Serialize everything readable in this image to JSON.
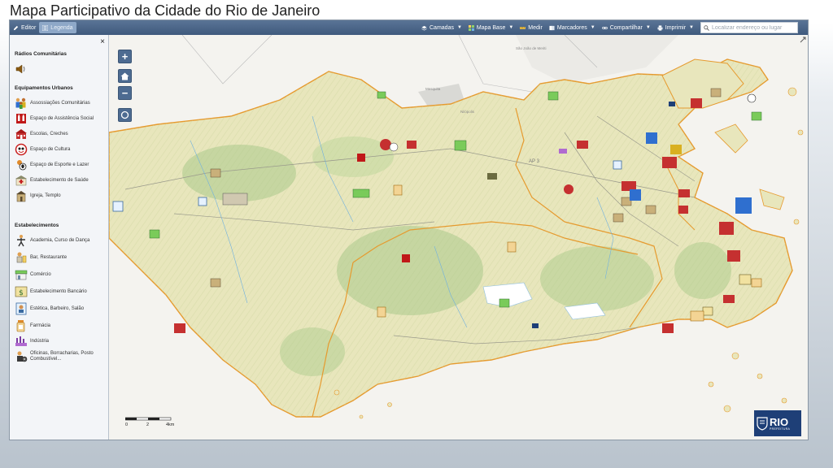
{
  "page": {
    "title": "Mapa Participativo da Cidade do Rio de Janeiro"
  },
  "toolbar": {
    "editor": "Editor",
    "legenda": "Legenda",
    "camadas": "Camadas",
    "mapa_base": "Mapa Base",
    "medir": "Medir",
    "marcadores": "Marcadores",
    "compartilhar": "Compartilhar",
    "imprimir": "Imprimir",
    "search_placeholder": "Localizar endereço ou lugar"
  },
  "legend": {
    "close": "×",
    "sections": [
      {
        "title": "Rádios Comunitárias",
        "items": [
          {
            "label": "",
            "icon": "radio-speaker-icon"
          }
        ]
      },
      {
        "title": "Equipamentos Urbanos",
        "items": [
          {
            "label": "Assossiações Comunitárias",
            "icon": "community-association-icon"
          },
          {
            "label": "Espaço de Assistência Social",
            "icon": "social-assistance-icon"
          },
          {
            "label": "Escolas, Creches",
            "icon": "school-icon"
          },
          {
            "label": "Espaço de Cultura",
            "icon": "culture-icon"
          },
          {
            "label": "Espaço de Esporte e Lazer",
            "icon": "sports-icon"
          },
          {
            "label": "Estabelecimento de Saúde",
            "icon": "health-icon"
          },
          {
            "label": "Igreja, Templo",
            "icon": "church-icon"
          }
        ]
      },
      {
        "title": "Estabelecimentos",
        "items": [
          {
            "label": "Academia, Curso de Dança",
            "icon": "gym-icon"
          },
          {
            "label": "Bar, Restaurante",
            "icon": "restaurant-icon"
          },
          {
            "label": "Comércio",
            "icon": "commerce-icon"
          },
          {
            "label": "Estabelecimento Bancário",
            "icon": "bank-icon"
          },
          {
            "label": "Estética, Barbeiro, Salão",
            "icon": "salon-icon"
          },
          {
            "label": "Farmácia",
            "icon": "pharmacy-icon"
          },
          {
            "label": "Indústria",
            "icon": "industry-icon"
          },
          {
            "label": "Oficinas, Borracharias, Posto Combustível...",
            "icon": "workshop-icon"
          }
        ]
      }
    ]
  },
  "map": {
    "zoom_in": "+",
    "zoom_out": "−",
    "places": [
      "São João de Meriti",
      "Mesquita",
      "Nilópolis",
      "AP 3"
    ],
    "scale": {
      "labels": [
        "0",
        "2",
        "4km"
      ]
    },
    "logo": {
      "text": "RIO",
      "subtext": "PREFEITURA"
    },
    "colors": {
      "land": "#e6e3b8",
      "boundary": "#e69a2e",
      "water": "#ffffff",
      "header": "#4a6689",
      "logo": "#1e3f77"
    }
  }
}
